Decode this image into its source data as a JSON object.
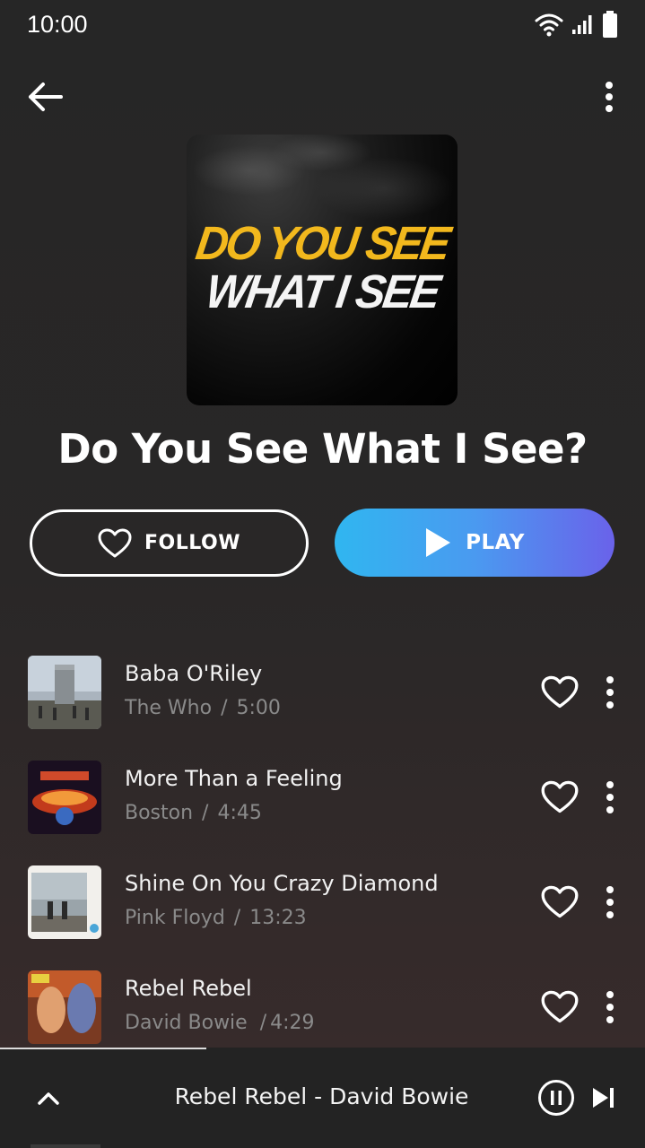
{
  "status": {
    "time": "10:00"
  },
  "colors": {
    "accent_gradient_start": "#30b6f0",
    "accent_gradient_end": "#6a62ea",
    "cover_yellow": "#f2b81d",
    "subtext": "#8a8a8a"
  },
  "cover": {
    "line1": "DO YOU SEE",
    "line2": "WHAT I SEE"
  },
  "playlist": {
    "title": "Do You See What I See?"
  },
  "actions": {
    "follow_label": "FOLLOW",
    "play_label": "PLAY"
  },
  "tracks": [
    {
      "title": "Baba O'Riley",
      "artist": "The Who",
      "separator": "/",
      "duration": "5:00"
    },
    {
      "title": "More Than a Feeling",
      "artist": "Boston",
      "separator": "/",
      "duration": "4:45"
    },
    {
      "title": "Shine On You Crazy Diamond",
      "artist": "Pink Floyd",
      "separator": "/",
      "duration": "13:23"
    },
    {
      "title": "Rebel Rebel",
      "artist": "David Bowie",
      "separator": "/",
      "duration": "4:29"
    }
  ],
  "now_playing": {
    "text": "Rebel Rebel - David Bowie",
    "progress": 0.32
  },
  "icons": [
    "wifi-icon",
    "signal-icon",
    "battery-icon",
    "back-arrow-icon",
    "more-vert-icon",
    "heart-outline-icon",
    "play-icon",
    "chevron-up-icon",
    "pause-icon",
    "skip-next-icon"
  ]
}
